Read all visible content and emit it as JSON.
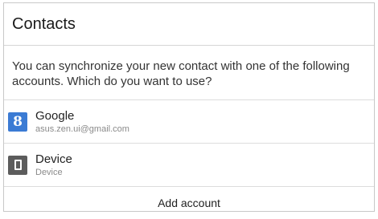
{
  "dialog": {
    "title": "Contacts",
    "message": "You can synchronize your new contact with one of the following accounts. Which do you want to use?",
    "accounts": [
      {
        "name": "Google",
        "detail": "asus.zen.ui@gmail.com",
        "icon": "google-icon",
        "icon_glyph": "8",
        "icon_color": "#3b7bd4"
      },
      {
        "name": "Device",
        "detail": "Device",
        "icon": "device-icon",
        "icon_color": "#5c5c5c"
      }
    ],
    "add_account_label": "Add account"
  }
}
